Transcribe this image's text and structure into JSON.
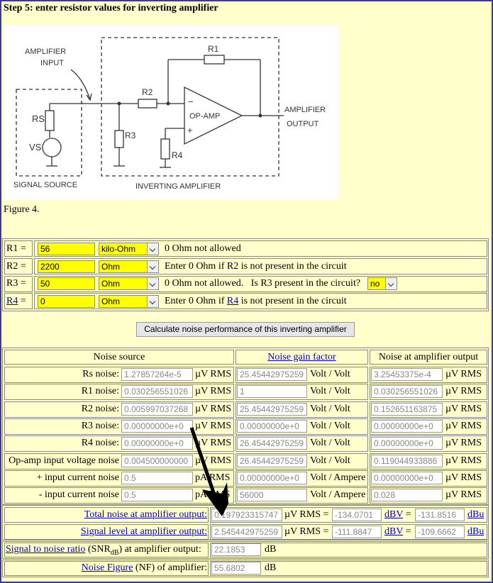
{
  "step_title": "Step 5: enter resistor values for inverting amplifier",
  "figure": {
    "caption": "Figure 4.",
    "labels": {
      "amp_input_1": "AMPLIFIER",
      "amp_input_2": "INPUT",
      "r1": "R1",
      "r2": "R2",
      "r3": "R3",
      "r4": "R4",
      "rs": "RS",
      "vs": "VS",
      "opamp": "OP-AMP",
      "minus": "−",
      "plus": "+",
      "amp_output_1": "AMPLIFIER",
      "amp_output_2": "OUTPUT",
      "signal_source": "SIGNAL SOURCE",
      "inverting_amplifier": "INVERTING AMPLIFIER"
    }
  },
  "resistors": [
    {
      "label": "R1 =",
      "value": "56",
      "unit": "kilo-Ohm",
      "note": "0 Ohm not allowed",
      "linked": false
    },
    {
      "label": "R2 =",
      "value": "2200",
      "unit": "Ohm",
      "note": "Enter 0 Ohm if R2 is not present in the circuit",
      "linked": false
    },
    {
      "label": "R3 =",
      "value": "50",
      "unit": "Ohm",
      "note": "0 Ohm not allowed.   Is R3 present in the circuit?",
      "present": "no",
      "linked": false
    },
    {
      "label": "R4",
      "eq": "=",
      "value": "0",
      "unit": "Ohm",
      "note_pre": "Enter 0 Ohm if ",
      "note_link": "R4",
      "note_post": " is not present in the circuit",
      "linked": true
    }
  ],
  "calc_button": "Calculate noise performance of this inverting amplifier",
  "table_headers": {
    "source": "Noise source",
    "gain": "Noise gain factor",
    "output": "Noise at amplifier output"
  },
  "noise_rows": [
    {
      "label": "Rs noise:",
      "src": "1.27857264e-5",
      "src_unit": "µV RMS",
      "gain": "25.45442975259",
      "gain_unit": "Volt / Volt",
      "out": "3.25453375e-4",
      "out_unit": "µV RMS"
    },
    {
      "label": "R1 noise:",
      "src": "0.030256551026",
      "src_unit": "µV RMS",
      "gain": "1",
      "gain_unit": "Volt / Volt",
      "out": "0.030256551026",
      "out_unit": "µV RMS"
    },
    {
      "label": "R2 noise:",
      "src": "0.005997037268",
      "src_unit": "µV RMS",
      "gain": "25.45442975259",
      "gain_unit": "Volt / Volt",
      "out": "0.152651163875",
      "out_unit": "µV RMS"
    },
    {
      "label": "R3 noise:",
      "src": "0.00000000e+0",
      "src_unit": "µV RMS",
      "gain": "0.00000000e+0",
      "gain_unit": "Volt / Volt",
      "out": "0.00000000e+0",
      "out_unit": "µV RMS"
    },
    {
      "label": "R4 noise:",
      "src": "0.00000000e+0",
      "src_unit": "µV RMS",
      "gain": "26.45442975259",
      "gain_unit": "Volt / Volt",
      "out": "0.00000000e+0",
      "out_unit": "µV RMS"
    },
    {
      "label": "Op-amp input voltage noise",
      "src": "0.004500000000",
      "src_unit": "µV RMS",
      "gain": "26.45442975259",
      "gain_unit": "Volt / Volt",
      "out": "0.119044933886",
      "out_unit": "µV RMS"
    },
    {
      "label": "+ input current noise",
      "src": "0.5",
      "src_unit": "pA RMS",
      "gain": "0.00000000e+0",
      "gain_unit": "Volt / Ampere",
      "out": "0.00000000e+0",
      "out_unit": "µV RMS"
    },
    {
      "label": "- input current noise",
      "src": "0.5",
      "src_unit": "pA RMS",
      "gain": "56000",
      "gain_unit": "Volt / Ampere",
      "out": "0.028",
      "out_unit": "µV RMS"
    }
  ],
  "totals": {
    "total_label": "Total noise at amplifier output:",
    "total_val": "0.197923315747",
    "total_unit": "µV RMS =",
    "total_dbv": "-134.0701",
    "signal_label": "Signal level at amplifier output:",
    "signal_val": "2.545442975259",
    "signal_unit": "µV RMS =",
    "signal_dbv": "-111.8847",
    "dbv_link": "dBV",
    "eq": "=",
    "total_dbu": "-131.8516",
    "signal_dbu": "-109.6662",
    "dbu_link": "dBu",
    "snr_link": "Signal to noise ratio",
    "snr_pre": " (SNR",
    "snr_sub": "dB",
    "snr_post": ") at amplifier output:",
    "snr_val": "22.1853",
    "snr_unit": "dB",
    "nf_link": "Noise Figure",
    "nf_post": " (NF) of amplifier:",
    "nf_val": "55.6802",
    "nf_unit": "dB"
  }
}
